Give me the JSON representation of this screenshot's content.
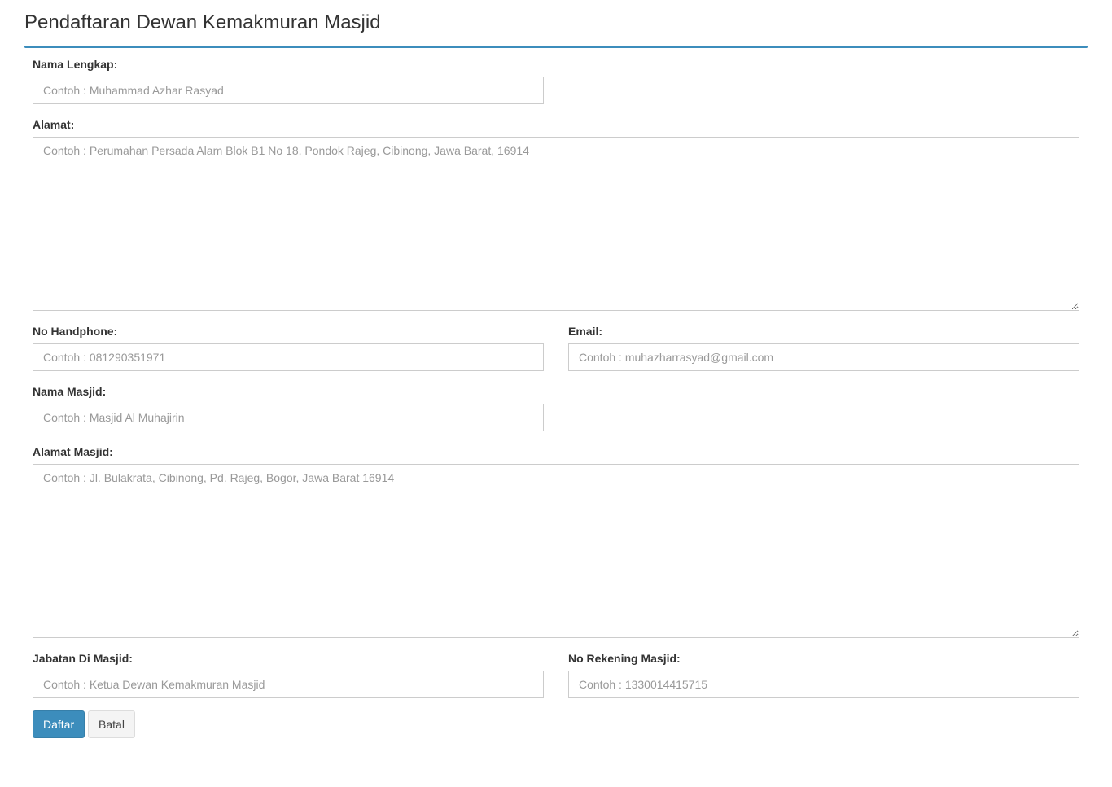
{
  "page": {
    "title": "Pendaftaran Dewan Kemakmuran Masjid"
  },
  "form": {
    "nama_lengkap": {
      "label": "Nama Lengkap:",
      "placeholder": "Contoh : Muhammad Azhar Rasyad",
      "value": ""
    },
    "alamat": {
      "label": "Alamat:",
      "placeholder": "Contoh : Perumahan Persada Alam Blok B1 No 18, Pondok Rajeg, Cibinong, Jawa Barat, 16914",
      "value": ""
    },
    "no_handphone": {
      "label": "No Handphone:",
      "placeholder": "Contoh : 081290351971",
      "value": ""
    },
    "email": {
      "label": "Email:",
      "placeholder": "Contoh : muhazharrasyad@gmail.com",
      "value": ""
    },
    "nama_masjid": {
      "label": "Nama Masjid:",
      "placeholder": "Contoh : Masjid Al Muhajirin",
      "value": ""
    },
    "alamat_masjid": {
      "label": "Alamat Masjid:",
      "placeholder": "Contoh : Jl. Bulakrata, Cibinong, Pd. Rajeg, Bogor, Jawa Barat 16914",
      "value": ""
    },
    "jabatan": {
      "label": "Jabatan Di Masjid:",
      "placeholder": "Contoh : Ketua Dewan Kemakmuran Masjid",
      "value": ""
    },
    "no_rekening": {
      "label": "No Rekening Masjid:",
      "placeholder": "Contoh : 1330014415715",
      "value": ""
    }
  },
  "actions": {
    "submit_label": "Daftar",
    "cancel_label": "Batal"
  },
  "colors": {
    "accent": "#3c8dbc",
    "placeholder": "#999999",
    "border": "#cccccc"
  }
}
